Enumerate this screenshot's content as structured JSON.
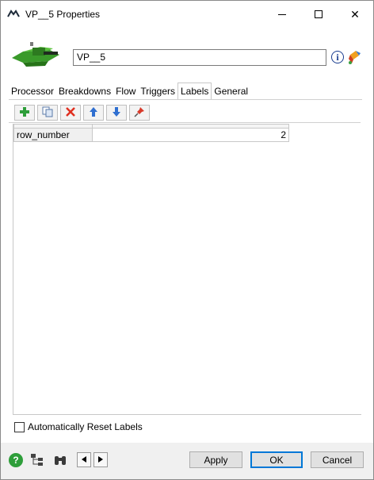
{
  "window": {
    "title": "VP__5 Properties",
    "app_icon": "app-logo-icon",
    "controls": {
      "minimize_icon": "minimize-icon",
      "maximize_icon": "maximize-icon",
      "close_symbol": "✕"
    }
  },
  "header": {
    "object_icon": "green-processor-object-icon",
    "name_value": "VP__5",
    "info_icon": "info-icon",
    "info_symbol": "i",
    "paint_icon": "paint-color-icon"
  },
  "tabs": [
    {
      "label": "Processor",
      "active": false
    },
    {
      "label": "Breakdowns",
      "active": false
    },
    {
      "label": "Flow",
      "active": false
    },
    {
      "label": "Triggers",
      "active": false
    },
    {
      "label": "Labels",
      "active": true
    },
    {
      "label": "General",
      "active": false
    }
  ],
  "toolbar": {
    "buttons": [
      {
        "icon": "add-icon"
      },
      {
        "icon": "duplicate-icon"
      },
      {
        "icon": "delete-icon"
      },
      {
        "icon": "move-up-icon"
      },
      {
        "icon": "move-down-icon"
      },
      {
        "icon": "pin-icon"
      }
    ]
  },
  "labels_table": {
    "rows": [
      {
        "name": "row_number",
        "value": "2"
      }
    ]
  },
  "options": {
    "auto_reset_label": "Automatically Reset Labels",
    "auto_reset_checked": false
  },
  "bottom": {
    "help_symbol": "?",
    "apply_label": "Apply",
    "ok_label": "OK",
    "cancel_label": "Cancel"
  },
  "colors": {
    "accent": "#0078d7",
    "object_green": "#3a9a2a",
    "help_green": "#2e9e3a",
    "delete_red": "#e03020",
    "arrow_blue": "#2f6fd0"
  }
}
